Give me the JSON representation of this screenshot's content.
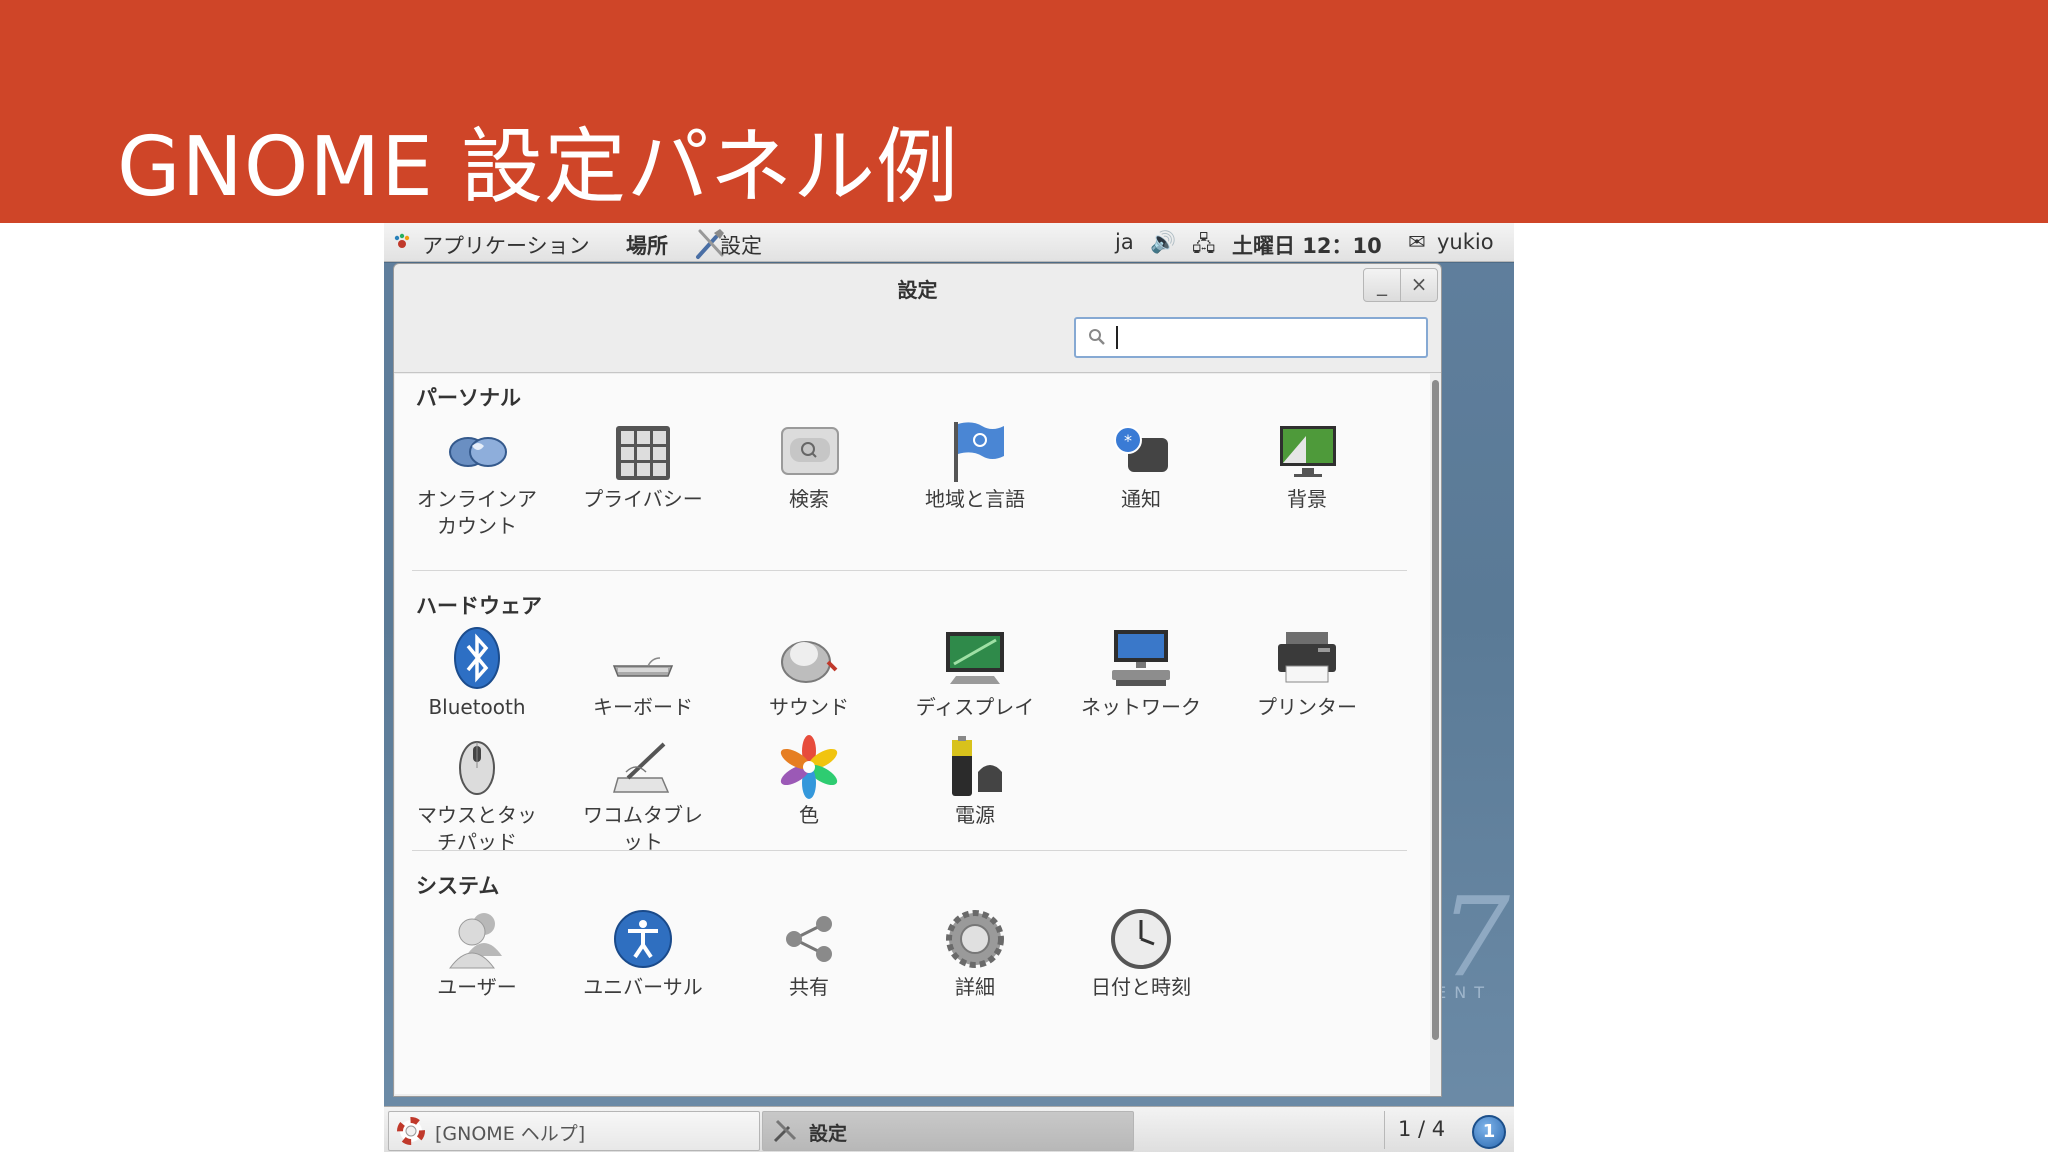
{
  "slide": {
    "title": "GNOME 設定パネル例"
  },
  "top_panel": {
    "applications": "アプリケーション",
    "places": "場所",
    "app_name": "設定",
    "input_lang": "ja",
    "clock": "土曜日 12：10",
    "user": "yukio"
  },
  "window": {
    "title": "設定",
    "minimize": "_",
    "close": "×",
    "search_value": ""
  },
  "sections": {
    "personal": {
      "title": "パーソナル",
      "items": [
        {
          "label": "オンラインア",
          "label2": "カウント",
          "icon": "online-accounts-icon"
        },
        {
          "label": "プライバシー",
          "label2": "",
          "icon": "privacy-icon"
        },
        {
          "label": "検索",
          "label2": "",
          "icon": "search-settings-icon"
        },
        {
          "label": "地域と言語",
          "label2": "",
          "icon": "region-flag-icon"
        },
        {
          "label": "通知",
          "label2": "",
          "icon": "notifications-icon"
        },
        {
          "label": "背景",
          "label2": "",
          "icon": "background-icon"
        }
      ]
    },
    "hardware": {
      "title": "ハードウェア",
      "items": [
        {
          "label": "Bluetooth",
          "label2": "",
          "icon": "bluetooth-icon"
        },
        {
          "label": "キーボード",
          "label2": "",
          "icon": "keyboard-icon"
        },
        {
          "label": "サウンド",
          "label2": "",
          "icon": "sound-icon"
        },
        {
          "label": "ディスプレイ",
          "label2": "",
          "icon": "display-icon"
        },
        {
          "label": "ネットワーク",
          "label2": "",
          "icon": "network-icon"
        },
        {
          "label": "プリンター",
          "label2": "",
          "icon": "printer-icon"
        },
        {
          "label": "マウスとタッ",
          "label2": "チパッド",
          "icon": "mouse-icon"
        },
        {
          "label": "ワコムタブレ",
          "label2": "ット",
          "icon": "wacom-tablet-icon"
        },
        {
          "label": "色",
          "label2": "",
          "icon": "color-icon"
        },
        {
          "label": "電源",
          "label2": "",
          "icon": "power-icon"
        }
      ]
    },
    "system": {
      "title": "システム",
      "items": [
        {
          "label": "ユーザー",
          "label2": "",
          "icon": "users-icon"
        },
        {
          "label": "ユニバーサル",
          "label2": "",
          "icon": "universal-access-icon"
        },
        {
          "label": "共有",
          "label2": "",
          "icon": "sharing-icon"
        },
        {
          "label": "詳細",
          "label2": "",
          "icon": "details-gear-icon"
        },
        {
          "label": "日付と時刻",
          "label2": "",
          "icon": "date-time-clock-icon"
        }
      ]
    }
  },
  "bottom_panel": {
    "task_help": "[GNOME ヘルプ]",
    "task_settings": "設定",
    "workspace": "1 / 4",
    "notification_count": "1"
  }
}
